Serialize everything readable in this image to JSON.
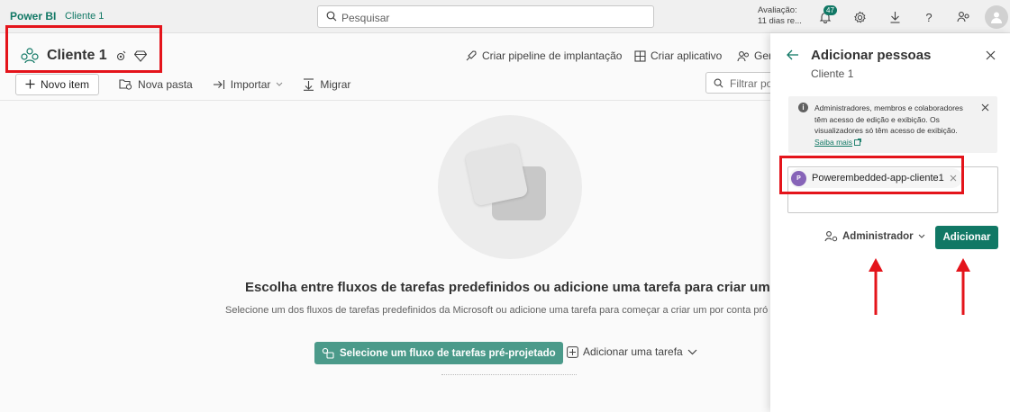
{
  "topbar": {
    "brand": "Power BI",
    "workspace": "Cliente 1",
    "search_placeholder": "Pesquisar",
    "trial_line1": "Avaliação:",
    "trial_line2": "11 dias re...",
    "notifications_count": "47"
  },
  "workspace_header": {
    "title": "Cliente 1",
    "actions": [
      "Criar pipeline de implantação",
      "Criar aplicativo",
      "Gere"
    ]
  },
  "toolbar": {
    "new_item": "Novo item",
    "new_folder": "Nova pasta",
    "import": "Importar",
    "migrate": "Migrar",
    "filter_placeholder": "Filtrar po"
  },
  "empty_state": {
    "title": "Escolha entre fluxos de tarefas predefinidos ou adicione uma tarefa para criar um",
    "subtitle": "Selecione um dos fluxos de tarefas predefinidos da Microsoft ou adicione uma tarefa para começar a criar um por conta pró",
    "primary_button": "Selecione um fluxo de tarefas pré-projetado",
    "secondary_button": "Adicionar uma tarefa"
  },
  "panel": {
    "title": "Adicionar pessoas",
    "subtitle": "Cliente 1",
    "info_text": "Administradores, membros e colaboradores têm acesso de edição e exibição. Os visualizadores só têm acesso de exibição.",
    "info_link": "Saiba mais",
    "chip_initial": "P",
    "chip_name": "Powerembedded-app-cliente1",
    "role": "Administrador",
    "add_button": "Adicionar"
  },
  "colors": {
    "accent": "#117865",
    "annotation_red": "#e4141b",
    "flow_button": "#4b9a8a"
  }
}
